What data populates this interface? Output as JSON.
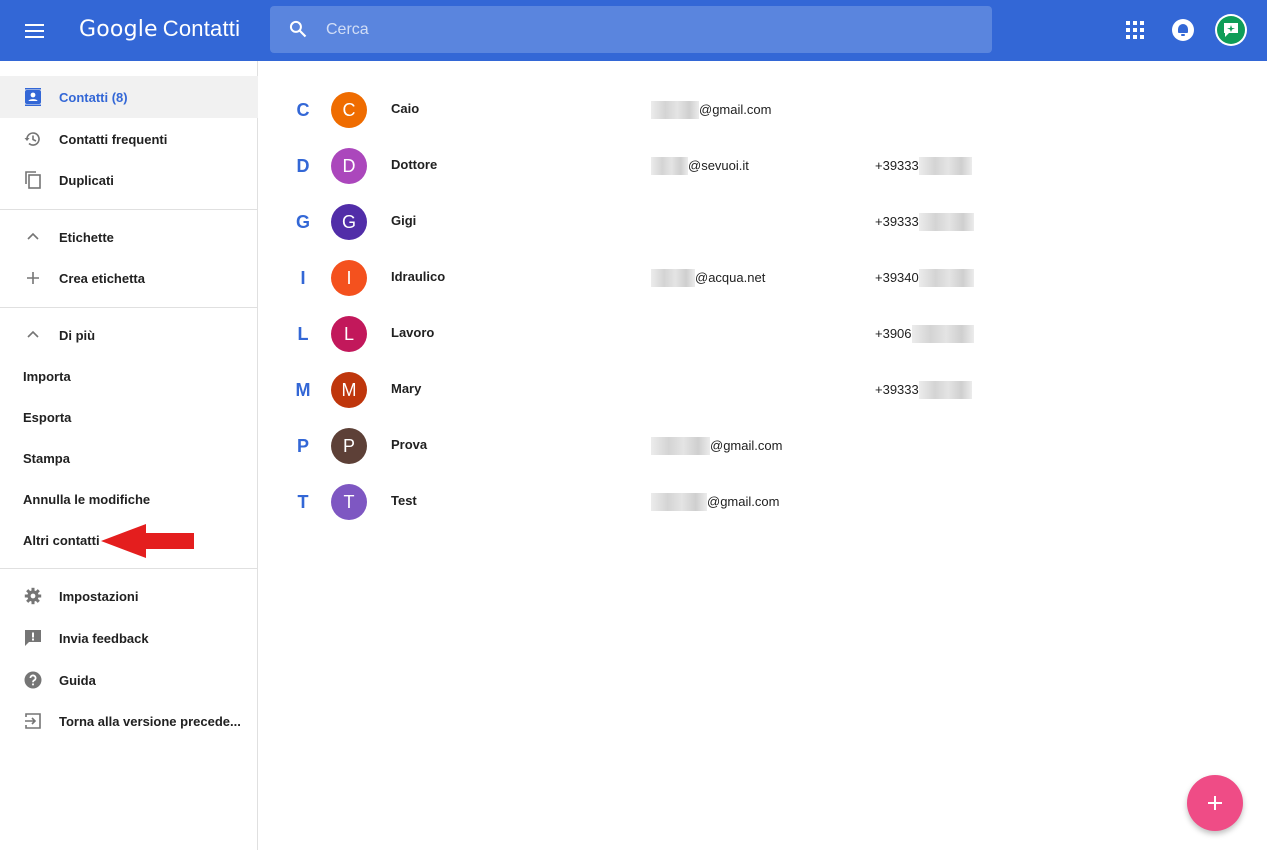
{
  "header": {
    "brand": "Google",
    "product": "Contatti",
    "search_placeholder": "Cerca"
  },
  "sidebar": {
    "items": [
      {
        "label": "Contatti (8)",
        "icon": "contacts-icon",
        "active": true
      },
      {
        "label": "Contatti frequenti",
        "icon": "history-icon"
      },
      {
        "label": "Duplicati",
        "icon": "duplicate-icon"
      },
      {
        "label": "Etichette",
        "icon": "chevron-up-icon"
      },
      {
        "label": "Crea etichetta",
        "icon": "plus-icon"
      },
      {
        "label": "Di più",
        "icon": "chevron-up-icon"
      },
      {
        "label": "Importa"
      },
      {
        "label": "Esporta"
      },
      {
        "label": "Stampa"
      },
      {
        "label": "Annulla le modifiche"
      },
      {
        "label": "Altri contatti"
      },
      {
        "label": "Impostazioni",
        "icon": "gear-icon"
      },
      {
        "label": "Invia feedback",
        "icon": "feedback-icon"
      },
      {
        "label": "Guida",
        "icon": "help-icon"
      },
      {
        "label": "Torna alla versione precede...",
        "icon": "exit-icon"
      }
    ]
  },
  "contacts": [
    {
      "letter": "C",
      "initial": "C",
      "name": "Caio",
      "email": "@gmail.com",
      "phone": "",
      "color": "#ef6c00"
    },
    {
      "letter": "D",
      "initial": "D",
      "name": "Dottore",
      "email": "@sevuoi.it",
      "phone": "+39333",
      "color": "#ab47bc"
    },
    {
      "letter": "G",
      "initial": "G",
      "name": "Gigi",
      "email": "",
      "phone": "+39333",
      "color": "#512da8"
    },
    {
      "letter": "I",
      "initial": "I",
      "name": "Idraulico",
      "email": "@acqua.net",
      "phone": "+39340",
      "color": "#f4511e"
    },
    {
      "letter": "L",
      "initial": "L",
      "name": "Lavoro",
      "email": "",
      "phone": "+3906",
      "color": "#c2185b"
    },
    {
      "letter": "M",
      "initial": "M",
      "name": "Mary",
      "email": "",
      "phone": "+39333",
      "color": "#bf360c"
    },
    {
      "letter": "P",
      "initial": "P",
      "name": "Prova",
      "email": "@gmail.com",
      "phone": "",
      "color": "#5d4037"
    },
    {
      "letter": "T",
      "initial": "T",
      "name": "Test",
      "email": "@gmail.com",
      "phone": "",
      "color": "#7e57c2"
    }
  ],
  "colors": {
    "header_bg": "#3367d6",
    "accent": "#3367d6",
    "fab": "#ef4c86"
  }
}
